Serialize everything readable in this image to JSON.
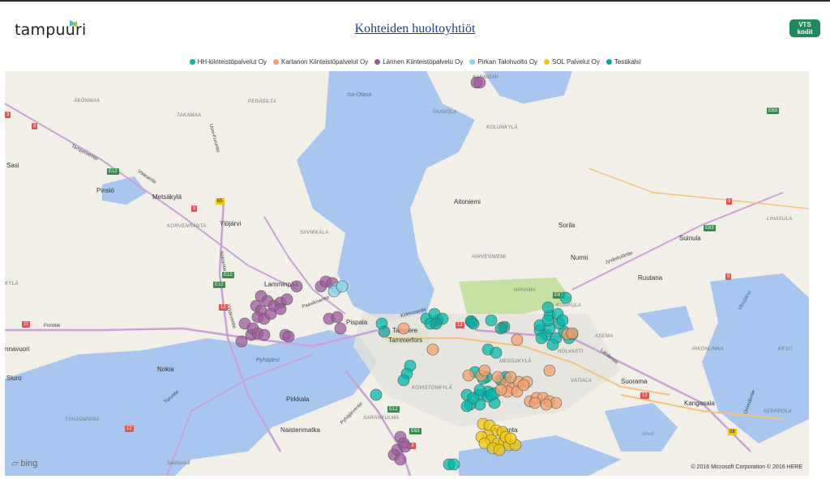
{
  "header": {
    "logo_text": "tampuuri",
    "title": "Kohteiden huoltoyhtiöt",
    "brand_logo_line1": "VTS",
    "brand_logo_line2": "kodit"
  },
  "legend": [
    {
      "label": "HH-kiinteistöpalvelut Oy",
      "color": "#01b8aa"
    },
    {
      "label": "Kartanon Kiinteistöpalvelut Oy",
      "color": "#f2a06e"
    },
    {
      "label": "Lännen Kiinteistöpalvelu Oy",
      "color": "#9c5a9c"
    },
    {
      "label": "Pirkan Talohuolto Oy",
      "color": "#8ad4eb"
    },
    {
      "label": "SOL Palvelut Oy",
      "color": "#f2c80f"
    },
    {
      "label": "Testikalsi",
      "color": "#14a39a"
    }
  ],
  "map": {
    "places": [
      {
        "name": "Sasi"
      },
      {
        "name": "Pinsiö"
      },
      {
        "name": "Metsäkylä"
      },
      {
        "name": "Ylöjärvi"
      },
      {
        "name": "Lamminpää"
      },
      {
        "name": "Pispala"
      },
      {
        "name": "Tampere"
      },
      {
        "name": "Tammerfors"
      },
      {
        "name": "Nokia"
      },
      {
        "name": "Siuro"
      },
      {
        "name": "Pirkkala"
      },
      {
        "name": "Naistenmatka"
      },
      {
        "name": "Hervanta"
      },
      {
        "name": "Suorama"
      },
      {
        "name": "Kangasala"
      },
      {
        "name": "Ruutana"
      },
      {
        "name": "Nurmi"
      },
      {
        "name": "Sorila"
      },
      {
        "name": "Aitoniemi"
      },
      {
        "name": "Suinula"
      },
      {
        "name": "nnavuori"
      },
      {
        "name": "Pyhäjärvi"
      },
      {
        "name": "Iso-Otava"
      },
      {
        "name": "Vesijärvi"
      }
    ],
    "districts": [
      "ÄKÖNMAA",
      "TAKAMAA",
      "PERÄSILTA",
      "PAAVOLA",
      "KOLUNKYLÄ",
      "KANNIEMI",
      "KORVENRANTA",
      "SIIVIKKALA",
      "HIRVENNIEMI",
      "NIIHAMA",
      "KUMPULA",
      "ASEMA",
      "HOLVASTI",
      "VATIALA",
      "MESSUKYLÄ",
      "KOVISTONKYLÄ",
      "SARANKULMA",
      "TYHJÄNPERÄ",
      "LIHASULA",
      "PIKONLINNA",
      "KESO",
      "KERPPOLA",
      "KYLÄ",
      "Ahuli",
      "Saviselkä"
    ],
    "roads": [
      "Tampereentie",
      "Vaasantie",
      "Porintie",
      "Nokiantie",
      "Turuntie",
      "Paasikiventie",
      "Lahdentie",
      "Jyväskyläntie",
      "Pyhäjärventie",
      "Orivedentie",
      "Ylöjärventie",
      "Kekkosentie",
      "Uusi-Kuruntie"
    ],
    "route_shields": [
      "3",
      "3",
      "65",
      "3",
      "11",
      "12",
      "12",
      "E12",
      "E12",
      "E63",
      "E63",
      "9",
      "9",
      "E63",
      "12",
      "58",
      "12",
      "E12",
      "E63",
      "12",
      "12",
      "E12"
    ],
    "attribution_logo": "bing",
    "copyright": "© 2016 Microsoft Corporation    © 2016 HERE"
  },
  "markers": {
    "HH-kiinteistöpalvelut Oy": 52,
    "Kartanon Kiinteistöpalvelut Oy": 26,
    "Lännen Kiinteistöpalvelu Oy": 34,
    "Pirkan Talohuolto Oy": 3,
    "SOL Palvelut Oy": 16,
    "Testikalsi": 4
  }
}
